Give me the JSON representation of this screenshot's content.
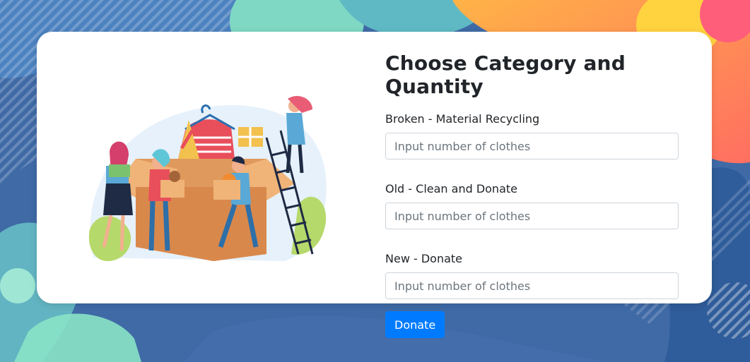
{
  "form": {
    "title": "Choose Category and Quantity",
    "fields": [
      {
        "label": "Broken - Material Recycling",
        "placeholder": "Input number of clothes",
        "value": ""
      },
      {
        "label": "Old - Clean and Donate",
        "placeholder": "Input number of clothes",
        "value": ""
      },
      {
        "label": "New - Donate",
        "placeholder": "Input number of clothes",
        "value": ""
      }
    ],
    "submit_label": "Donate"
  },
  "colors": {
    "background": "#3f6aa6",
    "card": "#ffffff",
    "primary_button": "#007bff",
    "text": "#212529"
  }
}
